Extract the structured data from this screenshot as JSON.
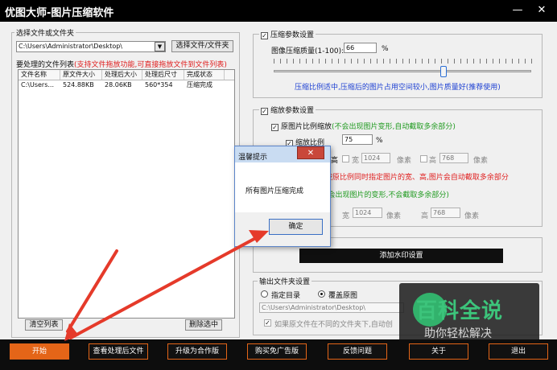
{
  "window": {
    "title": "优图大师-图片压缩软件",
    "minimize": "—",
    "close": "✕"
  },
  "left": {
    "select_group_label": "选择文件或文件夹",
    "path_value": "C:\\Users\\Administrator\\Desktop\\",
    "select_button": "选择文件/文件夹",
    "list_title": "要处理的文件列表",
    "list_hint": "(支持文件拖放功能,可直接拖放文件到文件列表)",
    "columns": [
      "文件名称",
      "原文件大小",
      "处理后大小",
      "处理后尺寸",
      "完成状态"
    ],
    "rows": [
      {
        "name": "C:\\Users...",
        "orig": "524.88KB",
        "after": "28.06KB",
        "dims": "560*354",
        "status": "压缩完成"
      }
    ],
    "clear_button": "清空列表",
    "delete_button": "删除选中"
  },
  "compress": {
    "label": "压缩参数设置",
    "quality_label": "图像压缩质量(1-100):",
    "quality_value": "66",
    "quality_unit": "%",
    "quality_fraction": 0.66,
    "hint": "压缩比例适中,压缩后的图片占用空间较小,图片质量好(推荐使用)"
  },
  "scale": {
    "label": "缩放参数设置",
    "keep_ratio_label": "原图片比例缩放",
    "keep_ratio_hint": "(不会出现图片变形,自动截取多余部分)",
    "scale_ratio_label": "缩放比例",
    "scale_ratio_value": "75",
    "scale_ratio_unit": "%",
    "height_frag": "高",
    "width_label": "宽",
    "width_value": "1024",
    "px_unit": "像素",
    "height_label": "高",
    "height_value": "768",
    "red_hint_frag": "按原比例同时指定图片的宽、高,图片会自动截取多余部分",
    "green_hint_frag": "(会出现图片的变形,不会截取多余部分)",
    "w2_label": "宽",
    "w2_value": "1024",
    "h2_label": "高",
    "h2_value": "768"
  },
  "watermark_button": "添加水印设置",
  "output": {
    "label": "输出文件夹设置",
    "option1": "指定目录",
    "option2": "覆盖原图",
    "path_value": "C:\\Users\\Administrator\\Desktop\\",
    "checkbox_label": "如果原文件在不同的文件夹下,自动创"
  },
  "dialog": {
    "title": "温馨提示",
    "message": "所有图片压缩完成",
    "ok_button": "确定",
    "close": "✕"
  },
  "bottom": {
    "start": "开始",
    "view_processed": "查看处理后文件",
    "upgrade": "升级为合作版",
    "buy": "购买免广告版",
    "feedback": "反馈问题",
    "about": "关于",
    "exit": "退出"
  },
  "watermark_overlay": {
    "big": "百科全说",
    "small": "助你轻松解决"
  },
  "colors": {
    "accent": "#e46518",
    "hint_red": "#e02020",
    "hint_green": "#1f9a1f",
    "hint_blue": "#1c3fd2",
    "annotation_arrow": "#e53a2a"
  }
}
